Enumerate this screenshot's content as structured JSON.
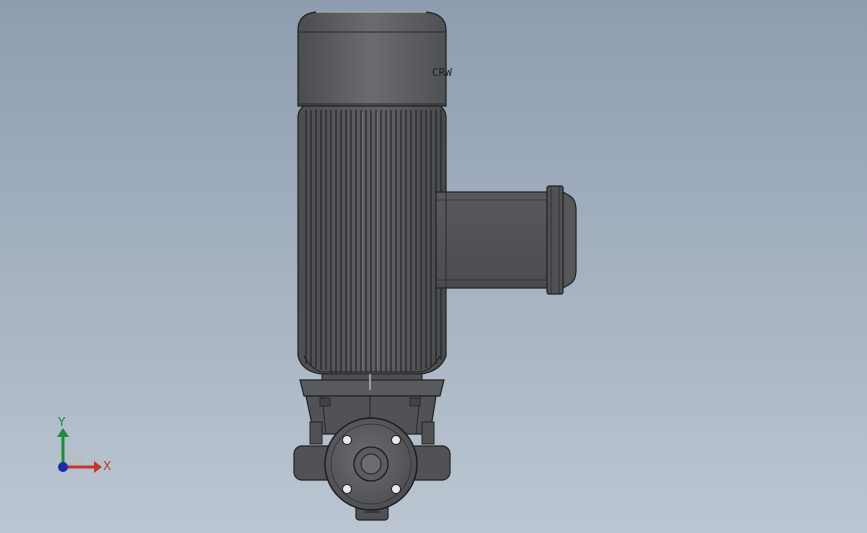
{
  "viewport": {
    "background_top": "#8d9db0",
    "background_bottom": "#bcc6d2"
  },
  "model": {
    "name_plate_text": "CRW"
  },
  "triad": {
    "x_label": "X",
    "y_label": "Y",
    "x_color": "#c0392b",
    "y_color": "#1e8b3a",
    "z_color": "#1a2ca8"
  }
}
